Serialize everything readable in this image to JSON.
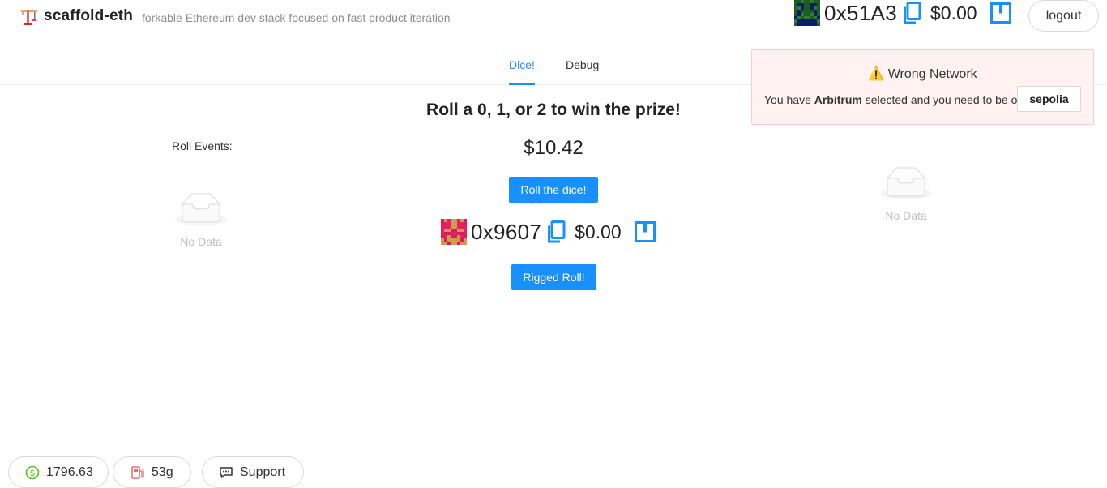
{
  "header": {
    "title": "scaffold-eth",
    "subtitle": "forkable Ethereum dev stack focused on fast product iteration",
    "logo_icon": "construction-crane-icon"
  },
  "account": {
    "address": "0x51A3",
    "balance": "$0.00",
    "logout_label": "logout",
    "blockie_colors": [
      "#1b5e20",
      "#2e7d32",
      "#0d1b6e"
    ]
  },
  "nav": {
    "tabs": [
      {
        "label": "Dice!",
        "active": true
      },
      {
        "label": "Debug",
        "active": false
      }
    ]
  },
  "alert": {
    "title": "⚠️ Wrong Network",
    "prefix": "You have",
    "network": "Arbitrum",
    "middle": "selected and you need to be on",
    "target_network": "sepolia"
  },
  "roll_events": {
    "label": "Roll Events:",
    "empty_text": "No Data"
  },
  "right_panel": {
    "empty_text": "No Data"
  },
  "game": {
    "headline": "Roll a 0, 1, or 2 to win the prize!",
    "prize": "$10.42",
    "roll_button": "Roll the dice!",
    "contract_address": "0x9607",
    "contract_balance": "$0.00",
    "rigged_button": "Rigged Roll!",
    "blockie_colors": [
      "#e91e63",
      "#c8a04a",
      "#d81b60"
    ]
  },
  "footer": {
    "eth_price": "1796.63",
    "gas": "53g",
    "support_label": "Support"
  },
  "colors": {
    "primary": "#1890ff",
    "alert_bg": "#fff2f0",
    "alert_border": "#ffccc7"
  }
}
